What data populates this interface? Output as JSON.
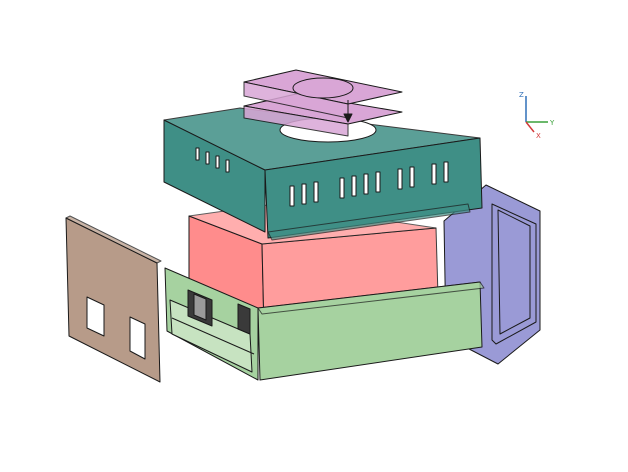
{
  "axis_triad": {
    "z_label": "Z",
    "y_label": "Y",
    "x_label": "X"
  },
  "colors": {
    "fan": "#d9a6d6",
    "top_cover": "#3f8f86",
    "power_block": "#ff8c8c",
    "side_panel": "#b79b89",
    "rear_panel": "#9a9ad6",
    "base_tray": "#a6d2a0",
    "connector": "#3a3a3a",
    "outline": "#1a1a1a",
    "background": "#ffffff",
    "axis_z": "#2f6fb8",
    "axis_y": "#3aa13a",
    "axis_x": "#d23a3a"
  }
}
